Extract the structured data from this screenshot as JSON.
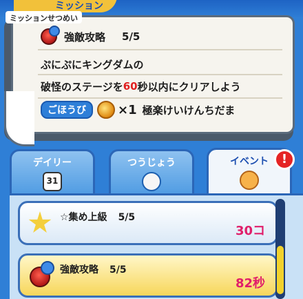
{
  "header": {
    "title": "ミッション",
    "subtitle": "ミッションせつめい"
  },
  "mission": {
    "name": "強敵攻略",
    "progress": "5/5",
    "description_line1": "ぷにぷにキングダムの",
    "description_line2_pre": "破怪のステージを",
    "description_line2_num": "60",
    "description_line2_post": "秒以内にクリアしよう",
    "reward_label": "ごほうび",
    "reward_multiplier": "×1",
    "reward_item": "極楽けいけんちだま"
  },
  "tabs": [
    {
      "label": "デイリー",
      "icon": "calendar-icon",
      "icon_text": "31"
    },
    {
      "label": "つうじょう",
      "icon": "flag-icon"
    },
    {
      "label": "イベント",
      "icon": "flag-icon-orange",
      "alert": "!"
    }
  ],
  "list": [
    {
      "name": "☆集め上級",
      "progress": "5/5",
      "value": "30コ",
      "icon": "star-icon"
    },
    {
      "name": "強敵攻略",
      "progress": "5/5",
      "value": "82秒",
      "icon": "enemy-icon"
    }
  ],
  "colors": {
    "accent": "#2f7fd6",
    "highlight": "#e02020",
    "value": "#e01e6a"
  }
}
